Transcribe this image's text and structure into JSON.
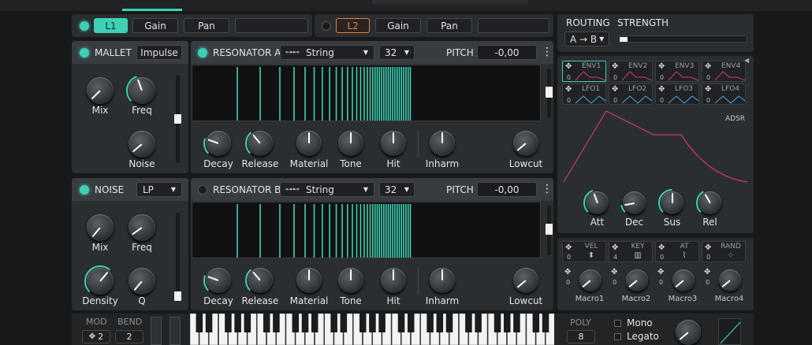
{
  "layer1": {
    "label": "L1",
    "gain": "Gain",
    "pan": "Pan"
  },
  "layer2": {
    "label": "L2",
    "gain": "Gain",
    "pan": "Pan"
  },
  "routing": {
    "label": "ROUTING",
    "strength": "STRENGTH",
    "value": "A → B",
    "strength_level": 0.04
  },
  "mallet": {
    "title": "MALLET",
    "type": "Impulse",
    "knobs": {
      "mix": "Mix",
      "freq": "Freq",
      "noise": "Noise"
    }
  },
  "noise": {
    "title": "NOISE",
    "type": "LP",
    "knobs": {
      "mix": "Mix",
      "freq": "Freq",
      "density": "Density",
      "q": "Q"
    }
  },
  "resA": {
    "title": "RESONATOR A",
    "model": "String",
    "partials": "32",
    "pitch_label": "PITCH",
    "pitch": "-0,00"
  },
  "resB": {
    "title": "RESONATOR B",
    "model": "String",
    "partials": "32",
    "pitch_label": "PITCH",
    "pitch": "-0,00"
  },
  "res_knobs": {
    "decay": "Decay",
    "release": "Release",
    "material": "Material",
    "tone": "Tone",
    "hit": "Hit",
    "inharm": "Inharm",
    "lowcut": "Lowcut"
  },
  "mod_sources": [
    "ENV1",
    "ENV2",
    "ENV3",
    "ENV4",
    "LFO1",
    "LFO2",
    "LFO3",
    "LFO4"
  ],
  "mod_counts": "0",
  "env": {
    "label": "ADSR",
    "att": "Att",
    "dec": "Dec",
    "sus": "Sus",
    "rel": "Rel"
  },
  "macro_sources": [
    {
      "name": "VEL",
      "count": "0"
    },
    {
      "name": "KEY",
      "count": "4"
    },
    {
      "name": "AT",
      "count": "0"
    },
    {
      "name": "RAND",
      "count": "0"
    }
  ],
  "macros": [
    "Macro1",
    "Macro2",
    "Macro3",
    "Macro4"
  ],
  "macro_counts": "0",
  "bottom": {
    "mod": "MOD",
    "bend": "BEND",
    "mod_value": "2",
    "bend_value": "2",
    "poly_label": "POLY",
    "poly": "8",
    "mono": "Mono",
    "legato": "Legato"
  },
  "colors": {
    "accent": "#3ed0b5",
    "layer2": "#e8803c",
    "env_curve": "#d23a5c"
  }
}
